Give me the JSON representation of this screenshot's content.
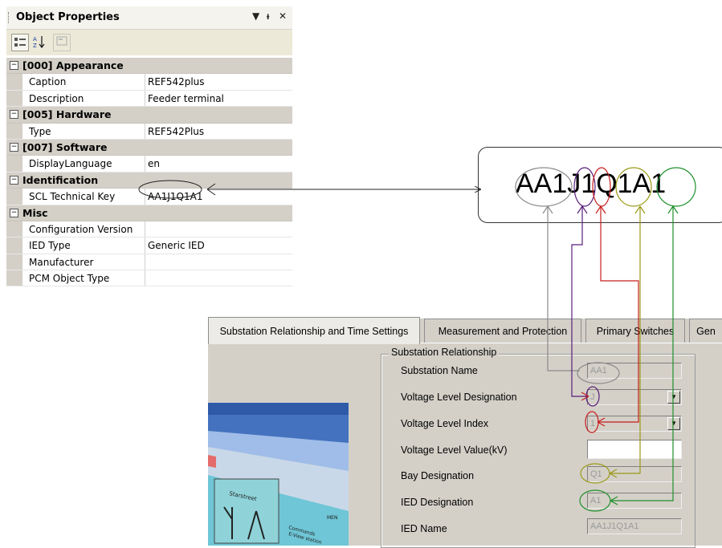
{
  "panel": {
    "title": "Object Properties",
    "controls": {
      "dropdown": "▼",
      "pin": "ᵖ",
      "close": "✕"
    },
    "toolbar": [
      "categorized-view",
      "alphabetical-sort",
      "property-pages"
    ],
    "categories": [
      {
        "name": "[000] Appearance",
        "props": [
          {
            "name": "Caption",
            "value": "REF542plus"
          },
          {
            "name": "Description",
            "value": "Feeder terminal"
          }
        ]
      },
      {
        "name": "[005] Hardware",
        "props": [
          {
            "name": "Type",
            "value": "REF542Plus"
          }
        ]
      },
      {
        "name": "[007] Software",
        "props": [
          {
            "name": "DisplayLanguage",
            "value": "en"
          }
        ]
      },
      {
        "name": "Identification",
        "props": [
          {
            "name": "SCL Technical Key",
            "value": "AA1J1Q1A1"
          }
        ]
      },
      {
        "name": "Misc",
        "props": [
          {
            "name": "Configuration Version",
            "value": ""
          },
          {
            "name": "IED Type",
            "value": "Generic IED"
          },
          {
            "name": "Manufacturer",
            "value": ""
          },
          {
            "name": "PCM Object Type",
            "value": ""
          }
        ]
      }
    ]
  },
  "key": {
    "parts": [
      "AA1",
      "J",
      "1",
      "Q1",
      "A1"
    ]
  },
  "dialog": {
    "tabs": [
      "Substation Relationship and Time Settings",
      "Measurement and Protection",
      "Primary Switches",
      "Gen"
    ],
    "group_label": "Substation Relationship",
    "fields": [
      {
        "label": "Substation Name",
        "value": "AA1"
      },
      {
        "label": "Voltage Level Designation",
        "value": "J"
      },
      {
        "label": "Voltage Level Index",
        "value": "1"
      },
      {
        "label": "Voltage Level Value(kV)",
        "value": ""
      },
      {
        "label": "Bay Designation",
        "value": "Q1"
      },
      {
        "label": "IED Designation",
        "value": "A1"
      },
      {
        "label": "IED Name",
        "value": "AA1J1Q1A1"
      }
    ]
  },
  "colors": {
    "gray": "#8a8a8a",
    "purple": "#5a1f7a",
    "red": "#c81e1e",
    "olive": "#9a9a1a",
    "green": "#1f8f2a"
  }
}
